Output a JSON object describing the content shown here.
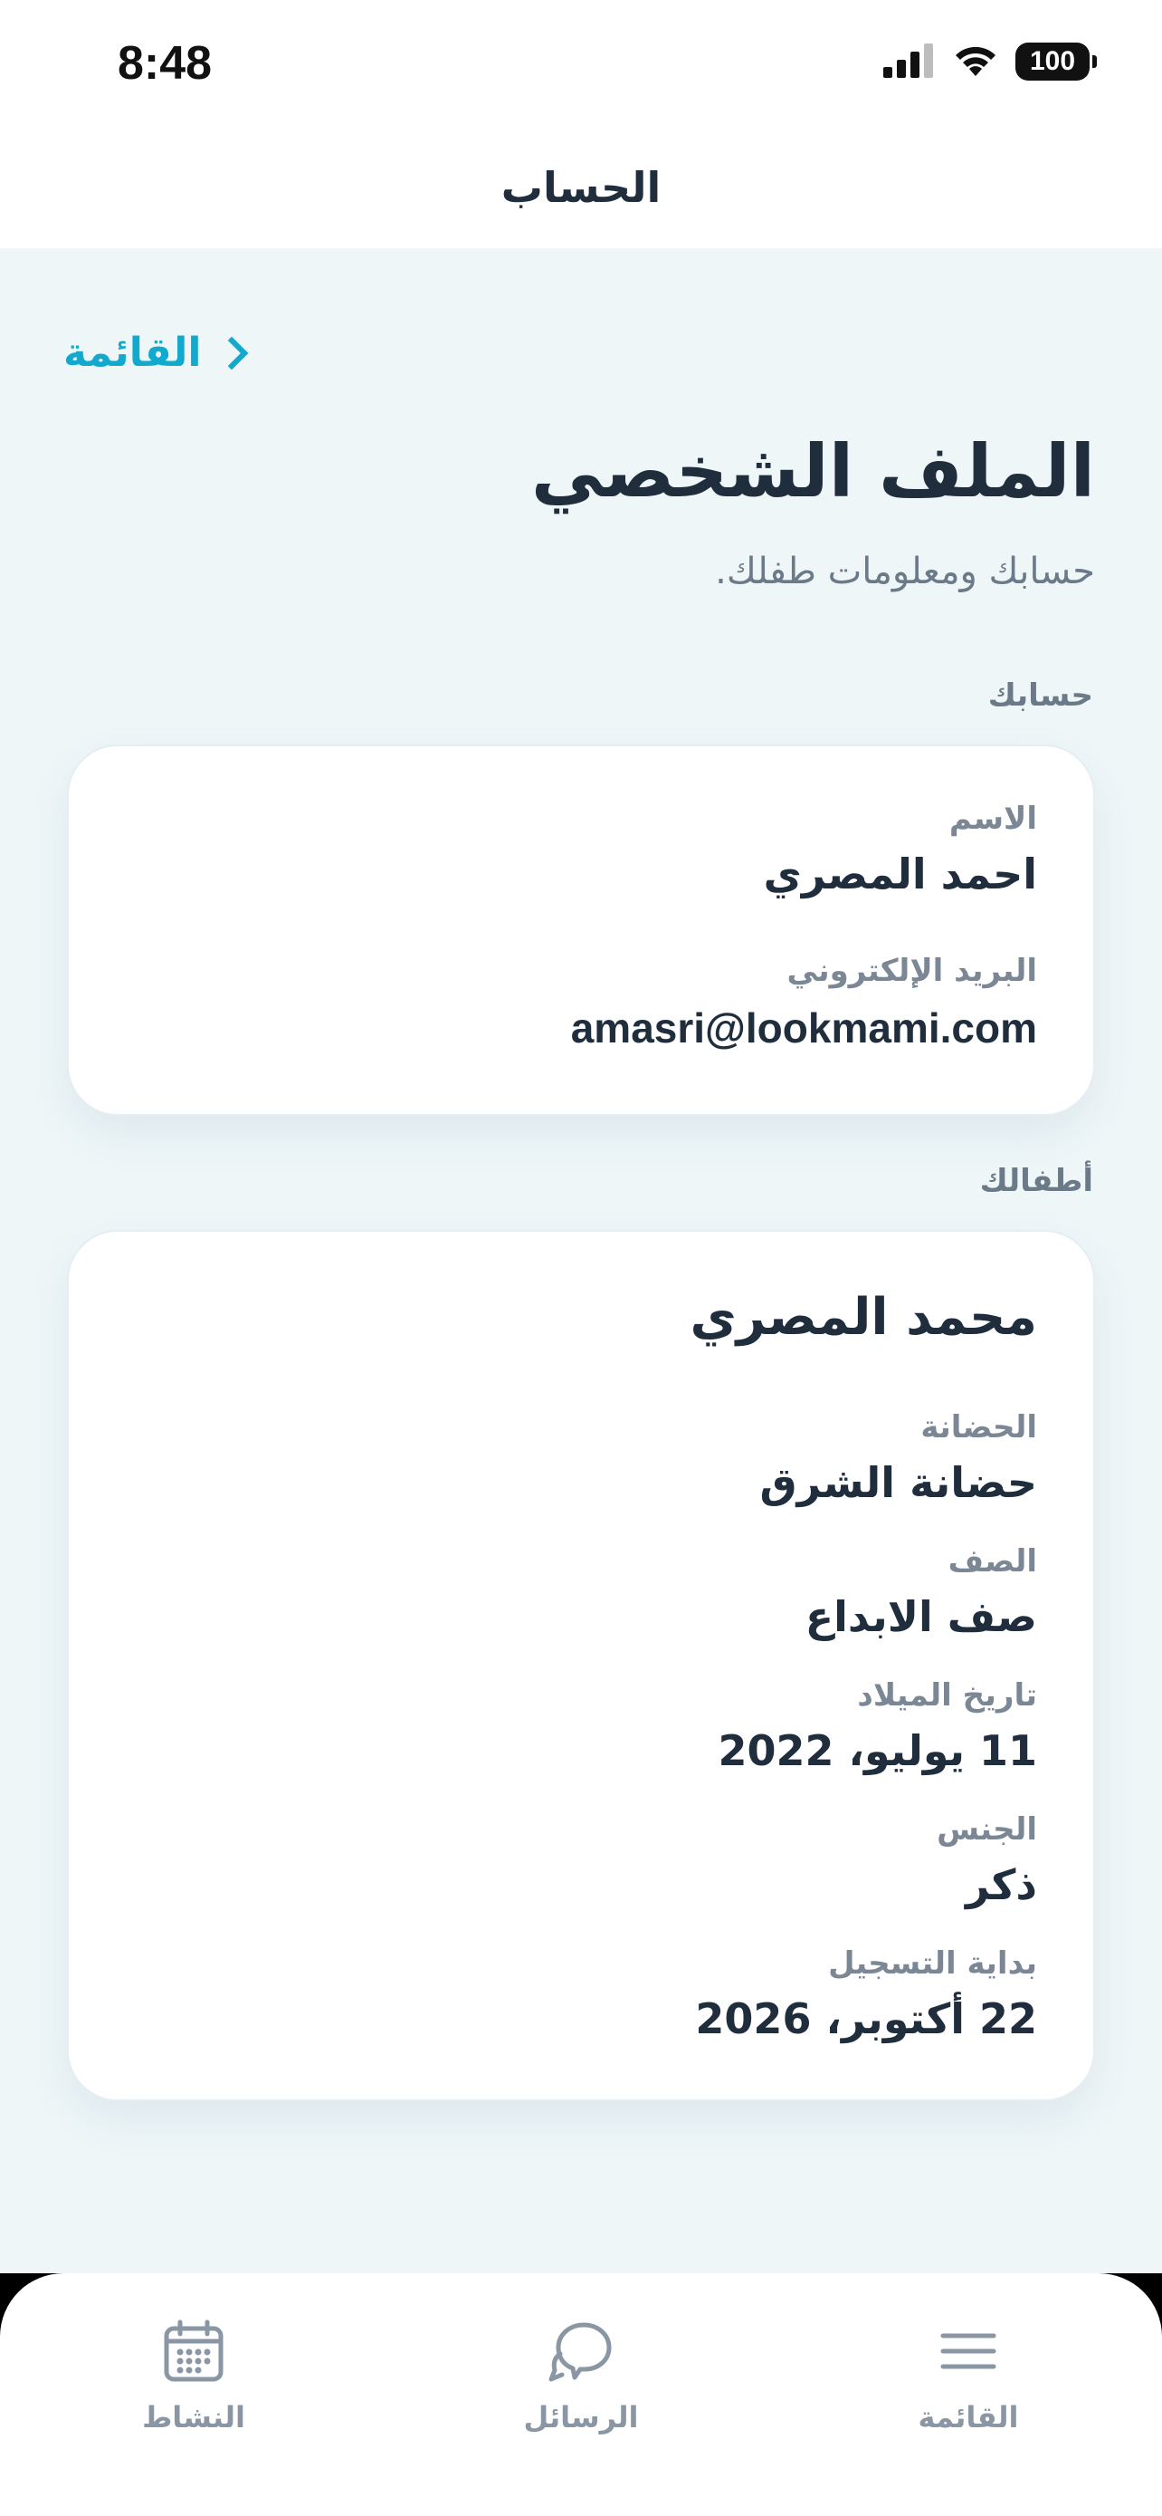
{
  "status_bar": {
    "time": "8:48",
    "battery": "100",
    "icons": [
      "signal-icon",
      "wifi-icon",
      "battery-icon"
    ]
  },
  "header": {
    "title": "الحساب"
  },
  "back_link": {
    "label": "القائمة"
  },
  "page": {
    "title": "الملف الشخصي",
    "subtitle": "حسابك ومعلومات طفلك."
  },
  "account_section": {
    "label": "حسابك",
    "name_label": "الاسم",
    "name_value": "احمد المصري",
    "email_label": "البريد الإلكتروني",
    "email_value": "amasri@lookmami.com"
  },
  "children_section": {
    "label": "أطفالك",
    "child": {
      "name": "محمد المصري",
      "nursery_label": "الحضانة",
      "nursery_value": "حضانة الشرق",
      "class_label": "الصف",
      "class_value": "صف الابداع",
      "birthdate_label": "تاريخ الميلاد",
      "birthdate_value": "11 يوليو، 2022",
      "gender_label": "الجنس",
      "gender_value": "ذكر",
      "enrollment_label": "بداية التسجيل",
      "enrollment_value": "22 أكتوبر، 2026"
    }
  },
  "tab_bar": {
    "tabs": [
      {
        "label": "النشاط",
        "icon": "calendar-icon"
      },
      {
        "label": "الرسائل",
        "icon": "chat-icon"
      },
      {
        "label": "القائمة",
        "icon": "menu-icon"
      }
    ]
  },
  "colors": {
    "accent": "#12a9cf",
    "text": "#1f2d3d",
    "muted": "#6b7a89",
    "background": "#eef6f8",
    "tab_icon": "#8a96a3"
  }
}
